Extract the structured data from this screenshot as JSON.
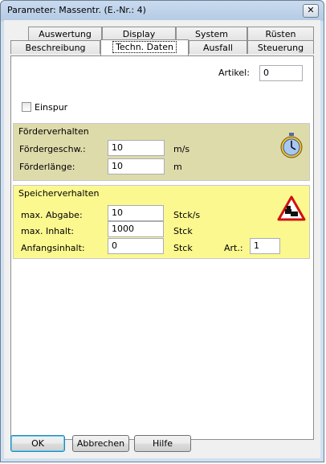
{
  "window": {
    "title": "Parameter: Massentr. (E.-Nr.: 4)",
    "close_glyph": "✕"
  },
  "tabs": {
    "row1": [
      {
        "label": "Auswertung"
      },
      {
        "label": "Display"
      },
      {
        "label": "System"
      },
      {
        "label": "Rüsten"
      }
    ],
    "row2": [
      {
        "label": "Beschreibung"
      },
      {
        "label": "Techn. Daten",
        "active": true
      },
      {
        "label": "Ausfall"
      },
      {
        "label": "Steuerung"
      }
    ]
  },
  "general": {
    "artikel_label": "Artikel:",
    "artikel_value": "0",
    "einspur_label": "Einspur",
    "einspur_checked": false
  },
  "foerderverhalten": {
    "title": "Förderverhalten",
    "bg_color": "#dedbab",
    "speed_label": "Fördergeschw.:",
    "speed_value": "10",
    "speed_unit": "m/s",
    "length_label": "Förderlänge:",
    "length_value": "10",
    "length_unit": "m",
    "icon": "stopwatch-icon"
  },
  "speicherverhalten": {
    "title": "Speicherverhalten",
    "bg_color": "#fbf890",
    "abgabe_label": "max. Abgabe:",
    "abgabe_value": "10",
    "abgabe_unit": "Stck/s",
    "inhalt_label": "max. Inhalt:",
    "inhalt_value": "1000",
    "inhalt_unit": "Stck",
    "anfang_label": "Anfangsinhalt:",
    "anfang_value": "0",
    "anfang_unit": "Stck",
    "art_label": "Art.:",
    "art_value": "1",
    "icon": "traffic-jam-warning-icon"
  },
  "buttons": {
    "ok": "OK",
    "abbrechen": "Abbrechen",
    "hilfe": "Hilfe"
  }
}
